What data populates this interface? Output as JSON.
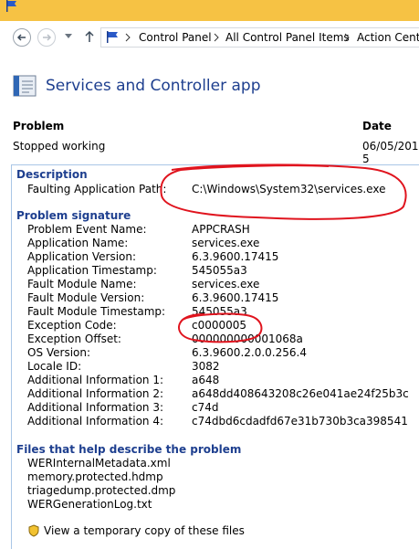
{
  "window": {
    "titlebar_color": "#f6c244"
  },
  "breadcrumb": [
    "Control Panel",
    "All Control Panel Items",
    "Action Center"
  ],
  "header": {
    "title": "Services and Controller app"
  },
  "columns": {
    "problem": "Problem",
    "date": "Date"
  },
  "problem_row": {
    "problem": "Stopped working",
    "date": "06/05/2015 5"
  },
  "description": {
    "title": "Description",
    "label": "Faulting Application Path:",
    "value": "C:\\Windows\\System32\\services.exe"
  },
  "signature": {
    "title": "Problem signature",
    "rows": [
      {
        "label": "Problem Event Name:",
        "value": "APPCRASH"
      },
      {
        "label": "Application Name:",
        "value": "services.exe"
      },
      {
        "label": "Application Version:",
        "value": "6.3.9600.17415"
      },
      {
        "label": "Application Timestamp:",
        "value": "545055a3"
      },
      {
        "label": "Fault Module Name:",
        "value": "services.exe"
      },
      {
        "label": "Fault Module Version:",
        "value": "6.3.9600.17415"
      },
      {
        "label": "Fault Module Timestamp:",
        "value": "545055a3"
      },
      {
        "label": "Exception Code:",
        "value": "c0000005"
      },
      {
        "label": "Exception Offset:",
        "value": "000000000001068a"
      },
      {
        "label": "OS Version:",
        "value": "6.3.9600.2.0.0.256.4"
      },
      {
        "label": "Locale ID:",
        "value": "3082"
      },
      {
        "label": "Additional Information 1:",
        "value": "a648"
      },
      {
        "label": "Additional Information 2:",
        "value": "a648dd408643208c26e041ae24f25b3c"
      },
      {
        "label": "Additional Information 3:",
        "value": "c74d"
      },
      {
        "label": "Additional Information 4:",
        "value": "c74dbd6cdadfd67e31b730b3ca398541"
      }
    ]
  },
  "files": {
    "title": "Files that help describe the problem",
    "items": [
      "WERInternalMetadata.xml",
      "memory.protected.hdmp",
      "triagedump.protected.dmp",
      "WERGenerationLog.txt"
    ]
  },
  "bottom_link": "View a temporary copy of these files",
  "colors": {
    "section_title": "#1e3f8f",
    "annotation": "#e0141e"
  }
}
